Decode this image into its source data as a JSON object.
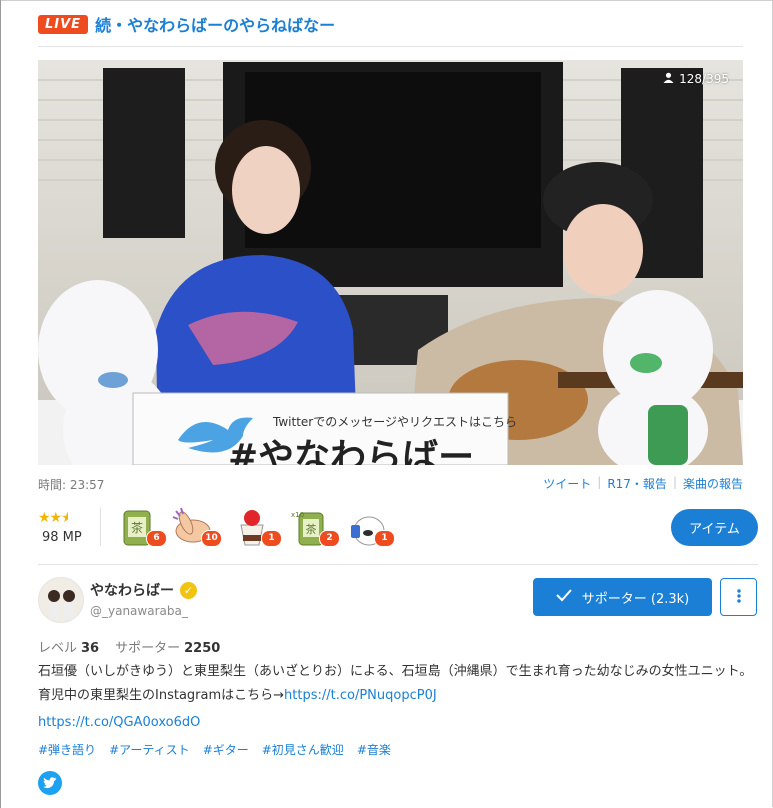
{
  "header": {
    "live_badge": "LIVE",
    "title": "続・やなわらばーのやらねばなー"
  },
  "player": {
    "viewers": "128/395",
    "viewers_icon": "person-icon",
    "board_text": "Twitterでのメッセージやリクエストはこちら",
    "board_hashtag": "#やなわらばー"
  },
  "meta": {
    "time_label": "時間: 23:57",
    "links": [
      "ツイート",
      "R17・報告",
      "楽曲の報告"
    ]
  },
  "rating": {
    "stars": 2.5,
    "mp": "98 MP"
  },
  "gifts": [
    {
      "icon": "tea-cup-icon",
      "count": "6"
    },
    {
      "icon": "clapping-hands-icon",
      "count": "10"
    },
    {
      "icon": "strawberry-parfait-icon",
      "count": "1"
    },
    {
      "icon": "tea-cup-x10-icon",
      "count": "2"
    },
    {
      "icon": "mascot-bird-icon",
      "count": "1"
    }
  ],
  "item_button": "アイテム",
  "user": {
    "name": "やなわらばー",
    "handle": "@_yanawaraba_",
    "supporter_button": "サポーター (2.3k)",
    "level_label": "レベル",
    "level": "36",
    "supporters_label": "サポーター",
    "supporters": "2250"
  },
  "description": {
    "text": "石垣優（いしがきゆう）と東里梨生（あいざとりお）による、石垣島（沖縄県）で生まれ育った幼なじみの女性ユニット。 育児中の東里梨生のInstagramはこちら→",
    "link": "https://t.co/PNuqopcP0J",
    "link2": "https://t.co/QGA0oxo6dO"
  },
  "tags": [
    "#弾き語り",
    "#アーティスト",
    "#ギター",
    "#初見さん歓迎",
    "#音楽"
  ],
  "colors": {
    "accent": "#1b7fd6",
    "live": "#ee4c1e",
    "star": "#f4b400",
    "badge": "#ee4c1e"
  }
}
